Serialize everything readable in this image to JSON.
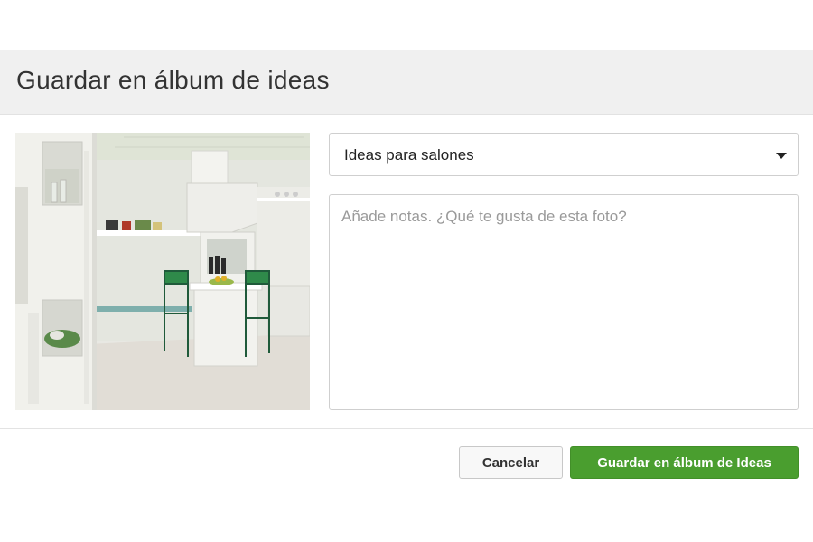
{
  "dialog": {
    "title": "Guardar en álbum de ideas"
  },
  "photo": {
    "icon": "kitchen-photo"
  },
  "album_select": {
    "selected": "Ideas para salones"
  },
  "notes": {
    "placeholder": "Añade notas. ¿Qué te gusta de esta foto?",
    "value": ""
  },
  "footer": {
    "cancel_label": "Cancelar",
    "save_label": "Guardar en álbum de Ideas"
  },
  "colors": {
    "primary": "#4a9e2f",
    "header_bg": "#f0f0f0"
  }
}
